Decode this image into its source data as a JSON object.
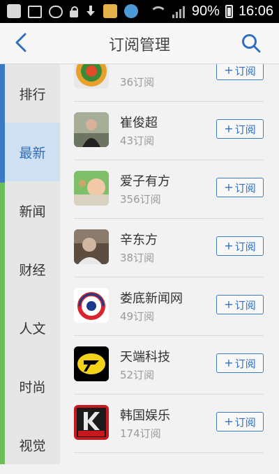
{
  "status_bar": {
    "battery": "90%",
    "time": "16:06"
  },
  "header": {
    "title": "订阅管理"
  },
  "sidebar": {
    "items": [
      {
        "label": "排行"
      },
      {
        "label": "最新"
      },
      {
        "label": "新闻"
      },
      {
        "label": "财经"
      },
      {
        "label": "人文"
      },
      {
        "label": "时尚"
      },
      {
        "label": "视觉"
      }
    ],
    "active": "最新"
  },
  "list": {
    "subscribe_label": "订阅",
    "items": [
      {
        "name": "",
        "count": "36订阅",
        "avatar": "partial-logo"
      },
      {
        "name": "崔俊超",
        "count": "43订阅",
        "avatar": "person-photo"
      },
      {
        "name": "爱子有方",
        "count": "356订阅",
        "avatar": "baby-photo"
      },
      {
        "name": "辛东方",
        "count": "38订阅",
        "avatar": "man-photo"
      },
      {
        "name": "娄底新闻网",
        "count": "49订阅",
        "avatar": "red-circle-logo"
      },
      {
        "name": "天端科技",
        "count": "52订阅",
        "avatar": "yellow-logo"
      },
      {
        "name": "韩国娱乐",
        "count": "174订阅",
        "avatar": "kpop-logo"
      }
    ]
  },
  "colors": {
    "accent": "#2f6fbf",
    "sidebar_green": "#6fbd5a"
  }
}
